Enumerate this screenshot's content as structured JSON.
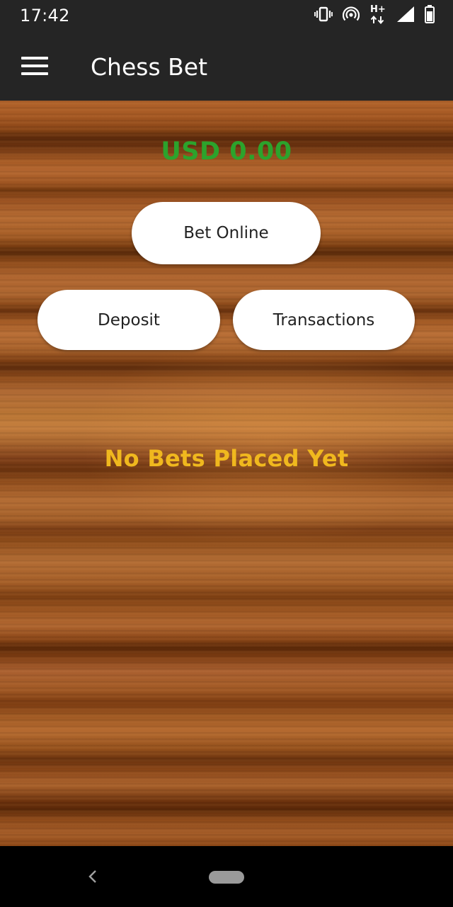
{
  "status_bar": {
    "time": "17:42",
    "icons": [
      "vibrate-icon",
      "hotspot-icon",
      "network-h-plus-icon",
      "signal-icon",
      "battery-icon"
    ],
    "network_label": "H+"
  },
  "app_bar": {
    "menu_icon": "hamburger-menu-icon",
    "title": "Chess Bet"
  },
  "main": {
    "balance": "USD 0.00",
    "buttons": {
      "bet_online": "Bet Online",
      "deposit": "Deposit",
      "transactions": "Transactions"
    },
    "empty_message": "No Bets Placed Yet"
  },
  "nav_bar": {
    "back_icon": "back-chevron-icon",
    "home_icon": "home-pill-icon"
  },
  "colors": {
    "bar_background": "#252525",
    "balance_green": "#2ca32c",
    "empty_message_yellow": "#f0b81e",
    "button_background": "#ffffff"
  }
}
